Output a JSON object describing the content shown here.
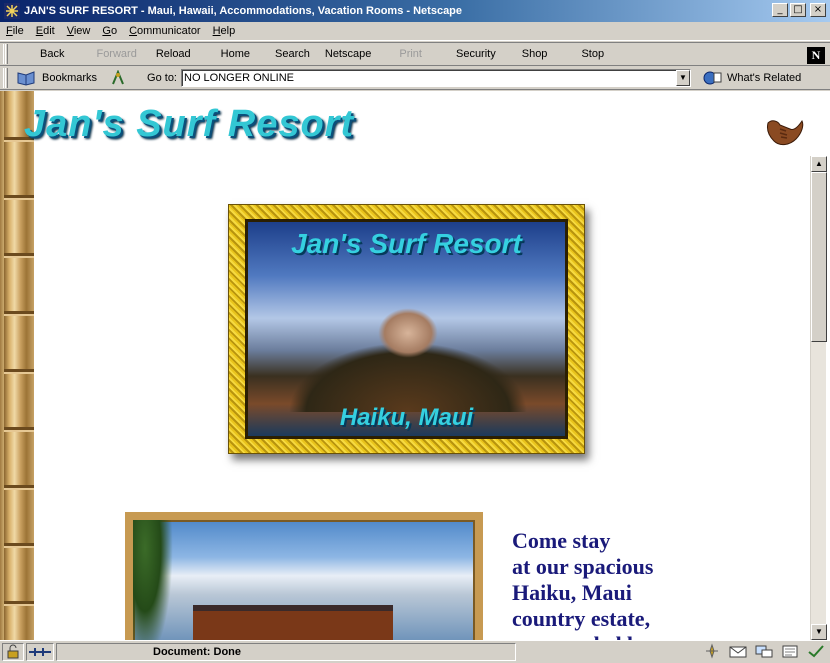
{
  "window": {
    "title": "JAN'S SURF RESORT - Maui, Hawaii, Accommodations, Vacation Rooms - Netscape",
    "controls": {
      "minimize": "_",
      "maximize": "□",
      "close": "×"
    }
  },
  "menu": [
    "File",
    "Edit",
    "View",
    "Go",
    "Communicator",
    "Help"
  ],
  "nav_toolbar": {
    "buttons": [
      {
        "label": "Back",
        "enabled": true
      },
      {
        "label": "Forward",
        "enabled": false
      },
      {
        "label": "Reload",
        "enabled": true
      },
      {
        "label": "Home",
        "enabled": true
      },
      {
        "label": "Search",
        "enabled": true
      },
      {
        "label": "Netscape",
        "enabled": true
      },
      {
        "label": "Print",
        "enabled": false
      },
      {
        "label": "Security",
        "enabled": true
      },
      {
        "label": "Shop",
        "enabled": true
      },
      {
        "label": "Stop",
        "enabled": true
      }
    ],
    "logo": "N"
  },
  "location_toolbar": {
    "bookmarks_label": "Bookmarks",
    "goto_label": "Go to:",
    "url": "NO LONGER ONLINE",
    "related_label": "What's Related"
  },
  "page": {
    "site_title": "Jan's Surf Resort",
    "hero_title": "Jan's Surf Resort",
    "hero_caption": "Haiku, Maui",
    "promo_lines": [
      "Come stay",
      "at our spacious",
      "Haiku, Maui",
      "country estate,",
      "surrounded by"
    ]
  },
  "status": {
    "text": "Document: Done"
  },
  "colors": {
    "title_cyan": "#33c7d4",
    "promo_navy": "#1a1a7a",
    "titlebar_blue": "#0a246a"
  }
}
